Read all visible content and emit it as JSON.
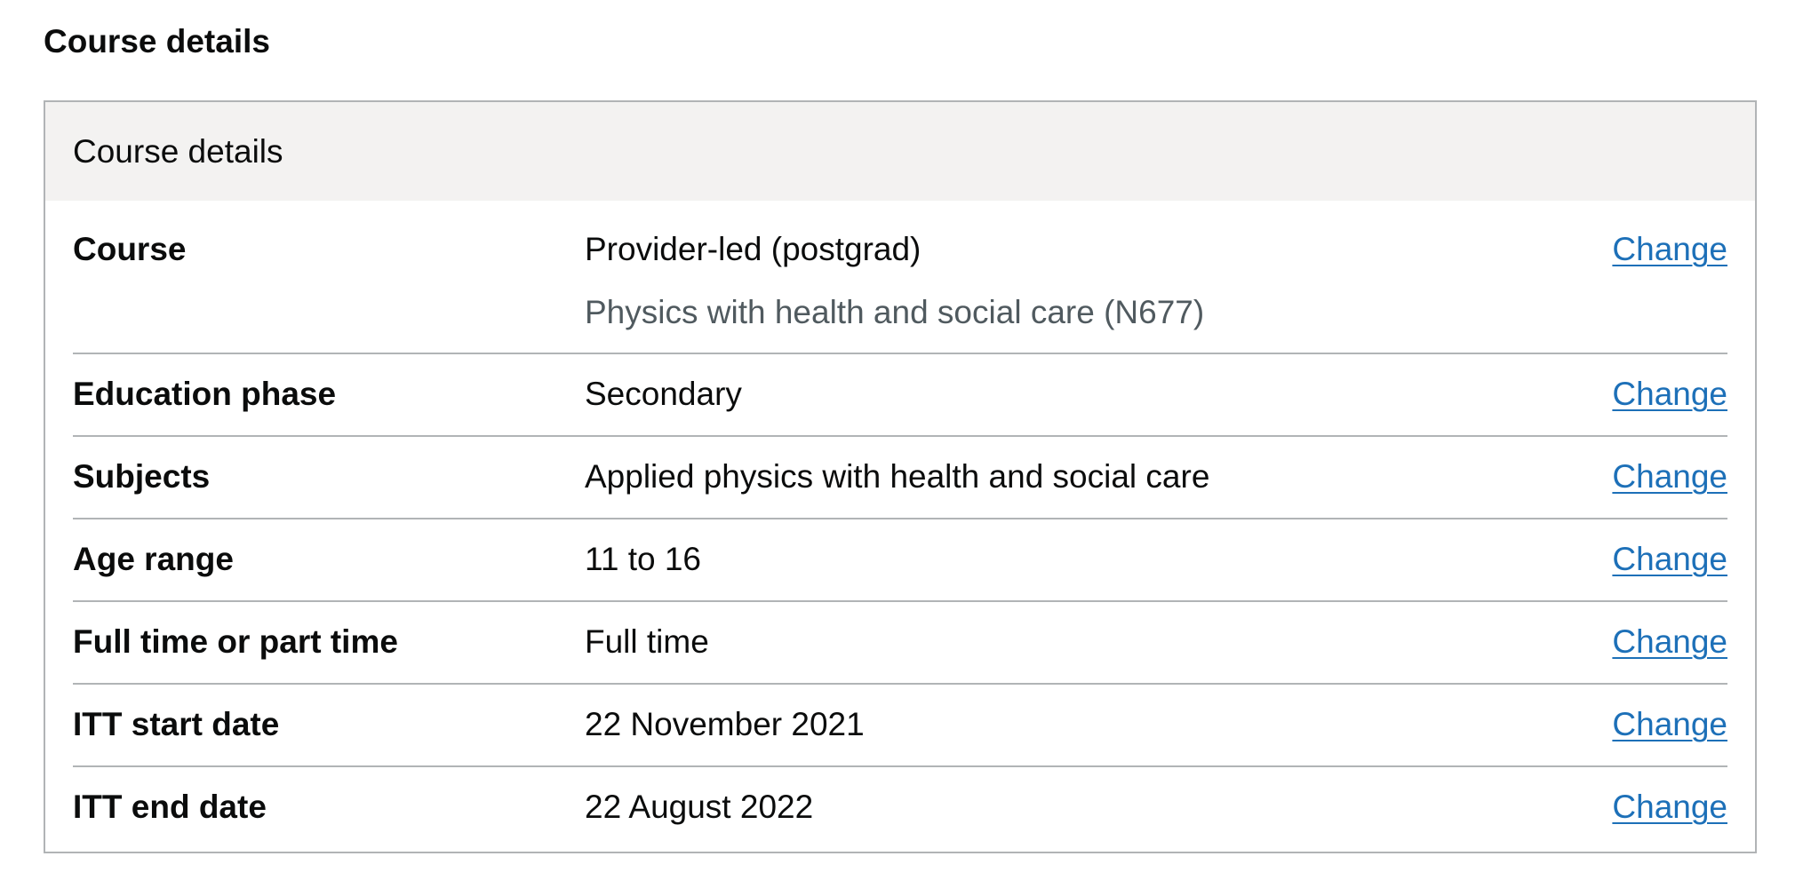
{
  "page": {
    "heading": "Course details"
  },
  "card": {
    "title": "Course details",
    "rows": [
      {
        "key": "Course",
        "value": "Provider-led (postgrad)",
        "hint": "Physics with health and social care (N677)",
        "action": "Change"
      },
      {
        "key": "Education phase",
        "value": "Secondary",
        "action": "Change"
      },
      {
        "key": "Subjects",
        "value": "Applied physics with health and social care",
        "action": "Change"
      },
      {
        "key": "Age range",
        "value": "11 to 16",
        "action": "Change"
      },
      {
        "key": "Full time or part time",
        "value": "Full time",
        "action": "Change"
      },
      {
        "key": "ITT start date",
        "value": "22 November 2021",
        "action": "Change"
      },
      {
        "key": "ITT end date",
        "value": "22 August 2022",
        "action": "Change"
      }
    ]
  },
  "colors": {
    "text": "#0b0c0c",
    "link": "#1d70b8",
    "secondary_text": "#505a5f",
    "border": "#b1b4b6",
    "header_background": "#f3f2f1"
  }
}
